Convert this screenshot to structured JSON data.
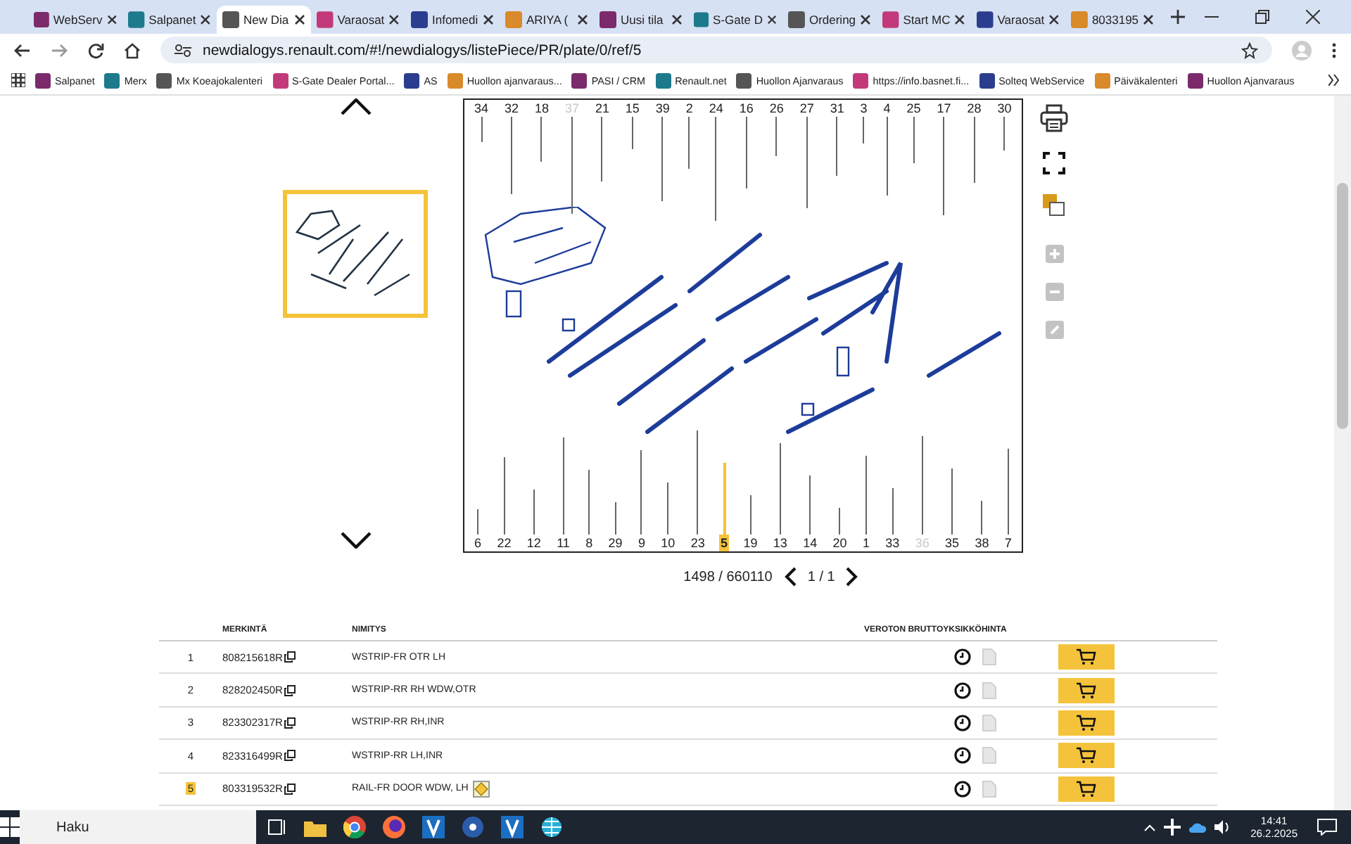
{
  "browser": {
    "tabs": [
      {
        "label": "WebServ",
        "selected": false
      },
      {
        "label": "Salpanet",
        "selected": false
      },
      {
        "label": "New Dia",
        "selected": true
      },
      {
        "label": "Varaosat",
        "selected": false
      },
      {
        "label": "Infomedi",
        "selected": false
      },
      {
        "label": "ARIYA (",
        "selected": false
      },
      {
        "label": "Uusi tila",
        "selected": false
      },
      {
        "label": "S-Gate D",
        "selected": false
      },
      {
        "label": "Ordering",
        "selected": false
      },
      {
        "label": "Start MC",
        "selected": false
      },
      {
        "label": "Varaosat",
        "selected": false
      },
      {
        "label": "8033195",
        "selected": false
      }
    ],
    "address": "newdialogys.renault.com/#!/newdialogys/listePiece/PR/plate/0/ref/5",
    "bookmarks": [
      "Salpanet",
      "Merx",
      "Mx Koeajokalenteri",
      "S-Gate Dealer Portal...",
      "AS",
      "Huollon ajanvaraus...",
      "PASI / CRM",
      "Renault.net",
      "Huollon Ajanvaraus",
      "https://info.basnet.fi...",
      "Solteq WebService",
      "Päiväkalenteri",
      "Huollon Ajanvaraus"
    ]
  },
  "plate": {
    "top_labels": [
      {
        "text": "34",
        "disabled": false,
        "selected": false
      },
      {
        "text": "32",
        "disabled": false,
        "selected": false
      },
      {
        "text": "18",
        "disabled": false,
        "selected": false
      },
      {
        "text": "37",
        "disabled": true,
        "selected": false
      },
      {
        "text": "21",
        "disabled": false,
        "selected": false
      },
      {
        "text": "15",
        "disabled": false,
        "selected": false
      },
      {
        "text": "39",
        "disabled": false,
        "selected": false
      },
      {
        "text": "2",
        "disabled": false,
        "selected": false
      },
      {
        "text": "24",
        "disabled": false,
        "selected": false
      },
      {
        "text": "16",
        "disabled": false,
        "selected": false
      },
      {
        "text": "26",
        "disabled": false,
        "selected": false
      },
      {
        "text": "27",
        "disabled": false,
        "selected": false
      },
      {
        "text": "31",
        "disabled": false,
        "selected": false
      },
      {
        "text": "3",
        "disabled": false,
        "selected": false
      },
      {
        "text": "4",
        "disabled": false,
        "selected": false
      },
      {
        "text": "25",
        "disabled": false,
        "selected": false
      },
      {
        "text": "17",
        "disabled": false,
        "selected": false
      },
      {
        "text": "28",
        "disabled": false,
        "selected": false
      },
      {
        "text": "30",
        "disabled": false,
        "selected": false
      }
    ],
    "bottom_labels": [
      {
        "text": "6",
        "disabled": false,
        "selected": false
      },
      {
        "text": "22",
        "disabled": false,
        "selected": false
      },
      {
        "text": "12",
        "disabled": false,
        "selected": false
      },
      {
        "text": "11",
        "disabled": false,
        "selected": false
      },
      {
        "text": "8",
        "disabled": false,
        "selected": false
      },
      {
        "text": "29",
        "disabled": false,
        "selected": false
      },
      {
        "text": "9",
        "disabled": false,
        "selected": false
      },
      {
        "text": "10",
        "disabled": false,
        "selected": false
      },
      {
        "text": "23",
        "disabled": false,
        "selected": false
      },
      {
        "text": "5",
        "disabled": false,
        "selected": true
      },
      {
        "text": "19",
        "disabled": false,
        "selected": false
      },
      {
        "text": "13",
        "disabled": false,
        "selected": false
      },
      {
        "text": "14",
        "disabled": false,
        "selected": false
      },
      {
        "text": "20",
        "disabled": false,
        "selected": false
      },
      {
        "text": "1",
        "disabled": false,
        "selected": false
      },
      {
        "text": "33",
        "disabled": false,
        "selected": false
      },
      {
        "text": "36",
        "disabled": true,
        "selected": false
      },
      {
        "text": "35",
        "disabled": false,
        "selected": false
      },
      {
        "text": "38",
        "disabled": false,
        "selected": false
      },
      {
        "text": "7",
        "disabled": false,
        "selected": false
      }
    ],
    "counter": "1498 / 660110",
    "page": "1 / 1"
  },
  "table": {
    "columns": [
      "MERKINTÄ",
      "NIMITYS",
      "VEROTON BRUTTOYKSIKKÖHINTA"
    ],
    "rows": [
      {
        "index": "1",
        "reference": "808215618R",
        "name": "WSTRIP-FR OTR LH",
        "selected": false,
        "alert": false
      },
      {
        "index": "2",
        "reference": "828202450R",
        "name": "WSTRIP-RR RH WDW,OTR",
        "selected": false,
        "alert": false
      },
      {
        "index": "3",
        "reference": "823302317R",
        "name": "WSTRIP-RR RH,INR",
        "selected": false,
        "alert": false
      },
      {
        "index": "4",
        "reference": "823316499R",
        "name": "WSTRIP-RR LH,INR",
        "selected": false,
        "alert": false
      },
      {
        "index": "5",
        "reference": "803319532R",
        "name": "RAIL-FR DOOR WDW, LH",
        "selected": true,
        "alert": true
      }
    ]
  },
  "taskbar": {
    "search_placeholder": "Haku",
    "time": "14:41",
    "date": "26.2.2025"
  }
}
